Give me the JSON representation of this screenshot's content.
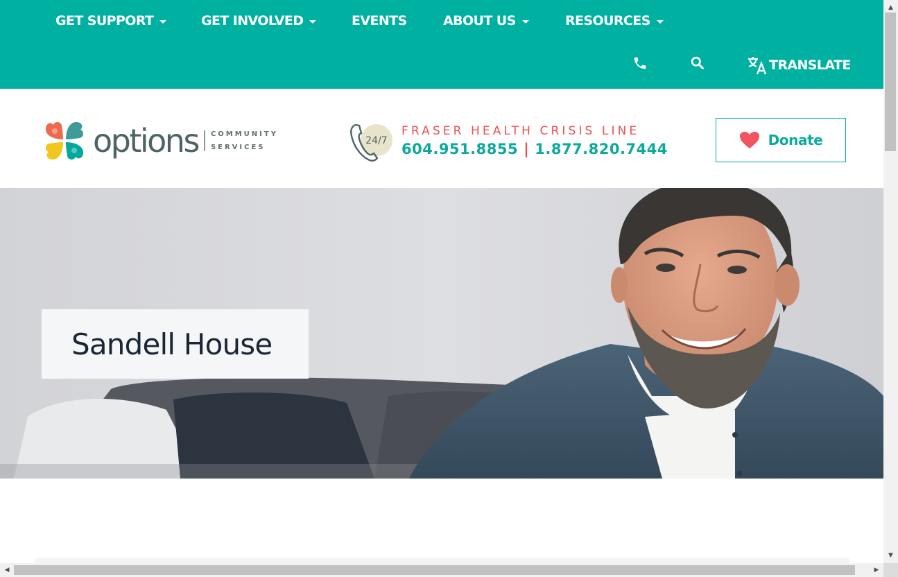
{
  "nav": {
    "items": [
      {
        "label": "GET SUPPORT",
        "dropdown": true
      },
      {
        "label": "GET INVOLVED",
        "dropdown": true
      },
      {
        "label": "EVENTS",
        "dropdown": false
      },
      {
        "label": "ABOUT US",
        "dropdown": true
      },
      {
        "label": "RESOURCES",
        "dropdown": true
      }
    ],
    "utility": {
      "phone_icon": "phone-icon",
      "search_icon": "search-icon",
      "translate_icon": "translate-icon",
      "translate_label": "TRANSLATE"
    },
    "colors": {
      "background": "#00b0a1",
      "text": "#ffffff"
    }
  },
  "header": {
    "logo": {
      "wordmark": "options",
      "tagline_line1": "COMMUNITY",
      "tagline_line2": "SERVICES",
      "colors": [
        "#ee6a4f",
        "#3f9a9a",
        "#f2c51f",
        "#00a99c"
      ]
    },
    "crisis": {
      "badge": "24/7",
      "title": "FRASER HEALTH CRISIS LINE",
      "phone_primary": "604.951.8855",
      "separator": "|",
      "phone_secondary": "1.877.820.7444",
      "colors": {
        "title": "#ee5050",
        "phones": "#0da99c"
      }
    },
    "donate": {
      "label": "Donate",
      "icon": "heart-icon",
      "heart_color": "#f2555f"
    }
  },
  "hero": {
    "title": "Sandell House",
    "image": "smiling-man-on-couch"
  },
  "scrollbars": {
    "up_arrow": "▲",
    "down_arrow": "▼",
    "left_arrow": "◀",
    "right_arrow": "▶"
  }
}
